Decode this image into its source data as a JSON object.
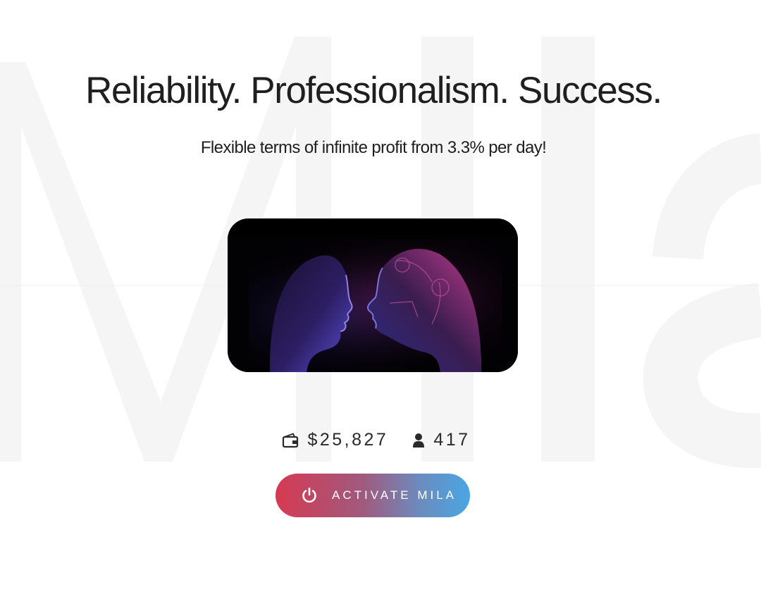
{
  "watermark": {
    "text": "MIla"
  },
  "hero": {
    "headline": "Reliability. Professionalism. Success.",
    "subheadline": "Flexible terms of infinite profit from 3.3% per day!"
  },
  "stats": {
    "balance": {
      "value": "$25,827",
      "icon": "wallet-icon"
    },
    "users": {
      "value": "417",
      "icon": "user-icon"
    }
  },
  "cta": {
    "label": "ACTIVATE MILA",
    "icon": "power-icon"
  },
  "colors": {
    "text": "#1f1f1f",
    "cta_gradient_start": "#d63a52",
    "cta_gradient_end": "#49a6e3",
    "watermark": "#f5f5f5"
  }
}
